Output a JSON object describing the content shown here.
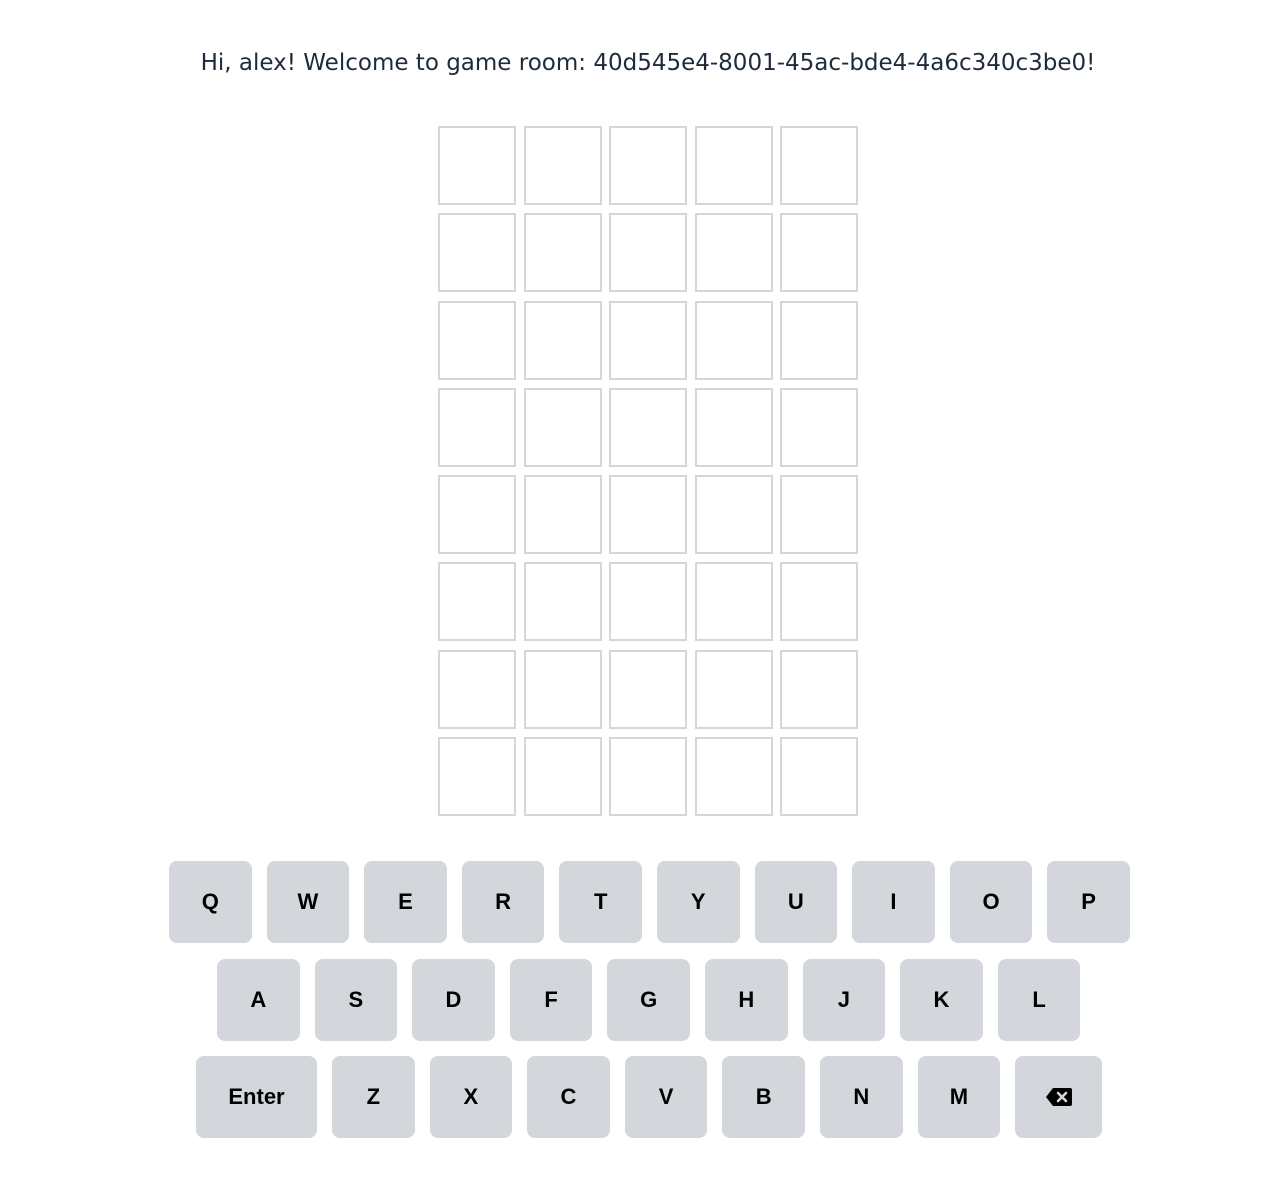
{
  "header": {
    "greeting": "Hi, alex! Welcome to game room: 40d545e4-8001-45ac-bde4-4a6c340c3be0!"
  },
  "board": {
    "rows": [
      [
        "",
        "",
        "",
        "",
        ""
      ],
      [
        "",
        "",
        "",
        "",
        ""
      ],
      [
        "",
        "",
        "",
        "",
        ""
      ],
      [
        "",
        "",
        "",
        "",
        ""
      ],
      [
        "",
        "",
        "",
        "",
        ""
      ],
      [
        "",
        "",
        "",
        "",
        ""
      ],
      [
        "",
        "",
        "",
        "",
        ""
      ],
      [
        "",
        "",
        "",
        "",
        ""
      ]
    ]
  },
  "keyboard": {
    "row1": [
      "Q",
      "W",
      "E",
      "R",
      "T",
      "Y",
      "U",
      "I",
      "O",
      "P"
    ],
    "row2": [
      "A",
      "S",
      "D",
      "F",
      "G",
      "H",
      "J",
      "K",
      "L"
    ],
    "row3": [
      "Enter",
      "Z",
      "X",
      "C",
      "V",
      "B",
      "N",
      "M"
    ],
    "backspace_icon": "backspace-icon"
  },
  "colors": {
    "tile_border": "#d3d6da",
    "key_background": "#d3d6da",
    "text": "#1e2b3a"
  }
}
